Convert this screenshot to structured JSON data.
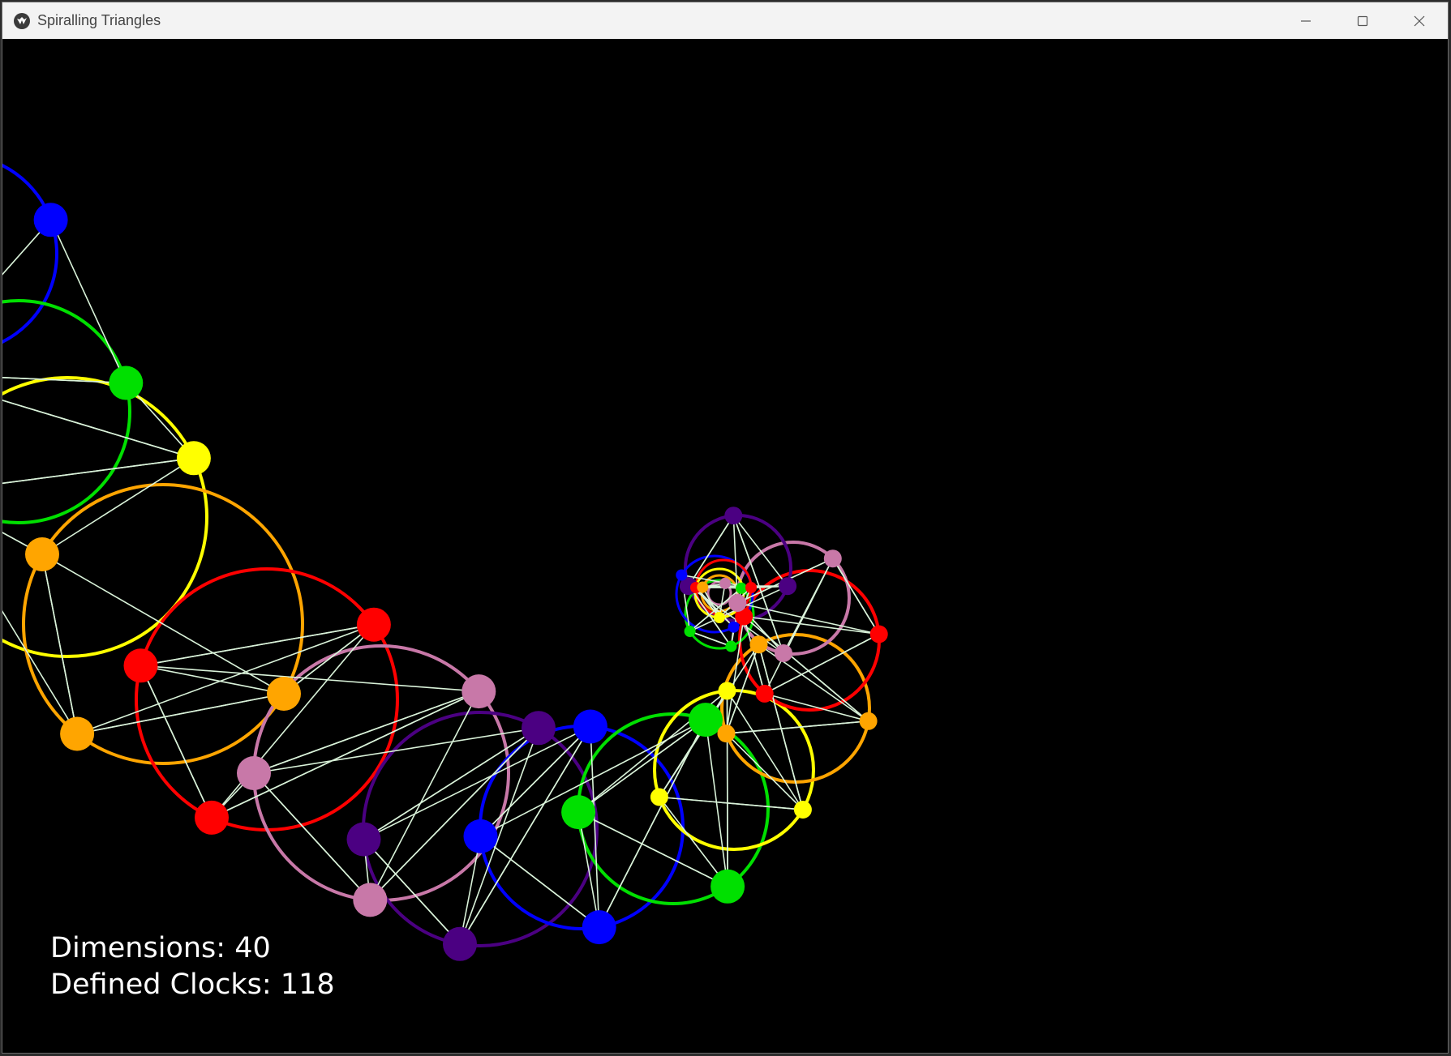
{
  "window": {
    "title": "Spiralling Triangles",
    "icon": "kivy-logo-icon"
  },
  "controls": {
    "minimize_icon": "minimize-icon",
    "maximize_icon": "maximize-icon",
    "close_icon": "close-icon"
  },
  "stats": {
    "dimensions_text": "Dimensions: 40",
    "defined_clocks_text": "Defined Clocks: 118"
  },
  "colors": {
    "canvas_background": "#000000",
    "titlebar_background": "#f3f3f3",
    "triangle_lines": "#d9f2d9",
    "palette": [
      "#0000ff",
      "#00e000",
      "#ffff00",
      "#ffa500",
      "#ff0000",
      "#c878a8",
      "#4b0082"
    ]
  }
}
